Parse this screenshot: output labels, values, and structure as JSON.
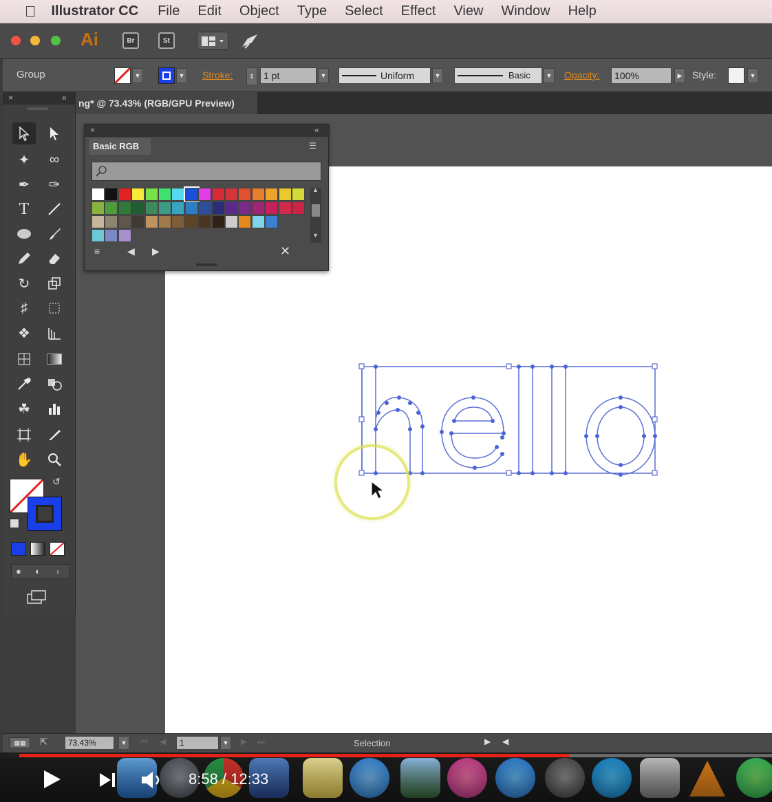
{
  "menubar": {
    "app_name": "Illustrator CC",
    "items": [
      "File",
      "Edit",
      "Object",
      "Type",
      "Select",
      "Effect",
      "View",
      "Window",
      "Help"
    ]
  },
  "appbar": {
    "logo": "Ai",
    "bridge_label": "Br",
    "stock_label": "St"
  },
  "control_bar": {
    "selection_label": "Group",
    "stroke_label": "Stroke:",
    "stroke_weight": "1 pt",
    "profile_label": "Uniform",
    "brush_label": "Basic",
    "opacity_label": "Opacity:",
    "opacity_value": "100%",
    "style_label": "Style:"
  },
  "document_tab": {
    "title": "ng* @ 73.43% (RGB/GPU Preview)"
  },
  "swatches_panel": {
    "tab_label": "Basic RGB",
    "swatch_rows": [
      [
        "#ffffff",
        "#111111",
        "#e02424",
        "#f7ec3a",
        "#7be14a",
        "#3fe06f",
        "#54d9ee",
        "#1a4fd8",
        "#e23ee6",
        "#d92a3a",
        "#d3353b",
        "#e0512f",
        "#e77f2c",
        "#eda32c",
        "#e8c92e",
        "#d6d93a"
      ],
      [
        "#88b43c",
        "#4f9c3e",
        "#2e7a38",
        "#215c32",
        "#3a8c5a",
        "#3e9a86",
        "#39a6c0",
        "#2e7dc4",
        "#2b4fa0",
        "#2a2c78",
        "#5a2a8a",
        "#7a2a88",
        "#a0237a",
        "#c8205a",
        "#d22a4e",
        "#c92346"
      ],
      [
        "#c8b79a",
        "#8f8371",
        "#5f574b",
        "#3f3a33",
        "#c0935e",
        "#a07a4a",
        "#7e5e38",
        "#5e4526",
        "#4a3620",
        "#2f2218",
        "#cccccc",
        "#e38a1f",
        "#7fd6e8",
        "#3a7fd0"
      ],
      [
        "#6ac8d8",
        "#7a8ac8",
        "#a88fd0"
      ]
    ]
  },
  "status_bar": {
    "zoom": "73.43%",
    "page": "1",
    "mode": "Selection"
  },
  "video": {
    "time": "8:58 / 12:33",
    "progress": 0.73
  },
  "artwork": {
    "text": "hello",
    "path_color": "#5a6fd6"
  }
}
